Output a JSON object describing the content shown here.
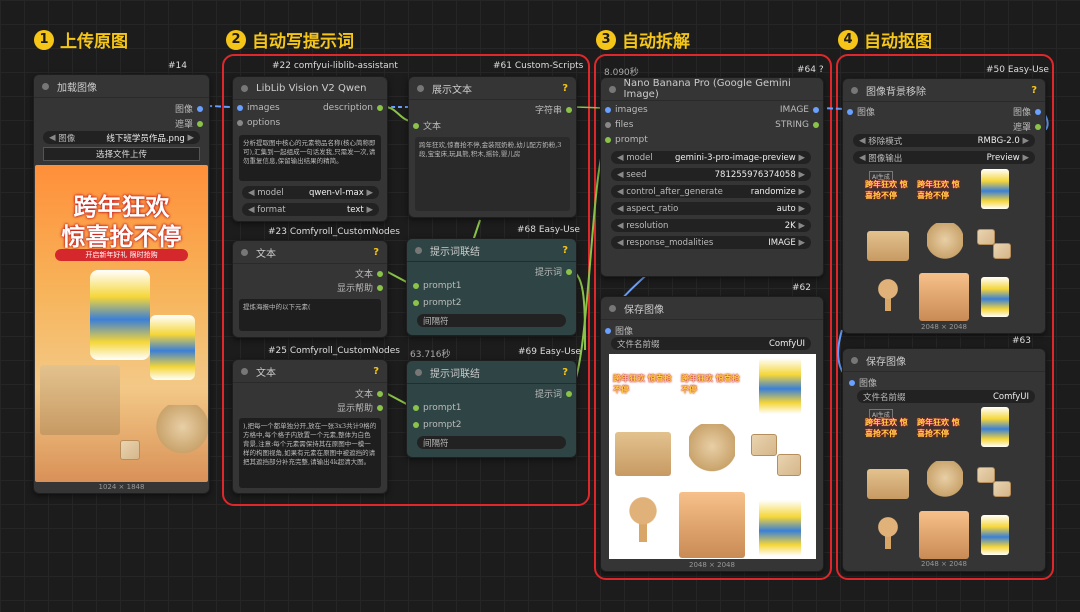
{
  "sections": [
    {
      "num": "1",
      "label": "上传原图"
    },
    {
      "num": "2",
      "label": "自动写提示词"
    },
    {
      "num": "3",
      "label": "自动拆解"
    },
    {
      "num": "4",
      "label": "自动抠图"
    }
  ],
  "colors": {
    "accent": "#f5c518",
    "group_border": "#e0282c",
    "image_port": "#6aa0ff",
    "string_port": "#8bc34a"
  },
  "nodes": {
    "load": {
      "id": "#14",
      "title": "加载图像",
      "out_image": "图像",
      "out_mask": "遮罩",
      "widget_label": "图像",
      "widget_value": "线下班学员作品.png",
      "button": "选择文件上传",
      "dims": "1024 × 1848"
    },
    "vision": {
      "id": "#22 comfyui-liblib-assistant",
      "title": "LibLib Vision V2 Qwen",
      "in_images": "images",
      "in_options": "options",
      "out_desc": "description",
      "text": "分析提取图中核心的元素物品名称(核心简称即可),汇集到一起组成一句话发我,只需发一次,请勿重复信息,保留输出结果的精简。",
      "model_label": "model",
      "model_value": "qwen-vl-max",
      "format_label": "format",
      "format_value": "text"
    },
    "show": {
      "id": "#61 Custom-Scripts",
      "title": "展示文本",
      "in_text": "文本",
      "out": "字符串",
      "text": "跨年狂欢,惊喜抢不停,金装冠奶粉,幼儿配方奶粉,3段,宝宝床,玩具熊,积木,摇铃,婴儿房"
    },
    "text23": {
      "id": "#23 Comfyroll_CustomNodes",
      "title": "文本",
      "out_text": "文本",
      "out_help": "显示帮助",
      "text": "提炼海报中的以下元素("
    },
    "concat68": {
      "id": "#68 Easy-Use",
      "title": "提示词联结",
      "out": "提示词",
      "p1": "prompt1",
      "p2": "prompt2",
      "sep": "间隔符"
    },
    "text25": {
      "id": "#25 Comfyroll_CustomNodes",
      "title": "文本",
      "out_text": "文本",
      "out_help": "显示帮助",
      "text": "),把每一个都单独分开,放在一张3x3共计9格的方格中,每个格子内放置一个元素,整体为白色背景,注意:每个元素需保持其在原图中一模一样的构图视角,如果有元素在原图中被遮挡的请把其遮挡部分补充完整,请输出4k超清大图。"
    },
    "concat69": {
      "id": "#69 Easy-Use",
      "time": "63.716秒",
      "title": "提示词联结",
      "out": "提示词",
      "p1": "prompt1",
      "p2": "prompt2",
      "sep": "间隔符"
    },
    "nano": {
      "id": "#64 ?",
      "time": "8.090秒",
      "title": "Nano Banana Pro (Google Gemini Image)",
      "in_images": "images",
      "in_files": "files",
      "in_prompt": "prompt",
      "out_image": "IMAGE",
      "out_string": "STRING",
      "widgets": [
        {
          "label": "model",
          "value": "gemini-3-pro-image-preview"
        },
        {
          "label": "seed",
          "value": "781255976374058"
        },
        {
          "label": "control_after_generate",
          "value": "randomize"
        },
        {
          "label": "aspect_ratio",
          "value": "auto"
        },
        {
          "label": "resolution",
          "value": "2K"
        },
        {
          "label": "response_modalities",
          "value": "IMAGE"
        }
      ]
    },
    "save62": {
      "id": "#62",
      "title": "保存图像",
      "in": "图像",
      "prefix_label": "文件名前缀",
      "prefix_value": "ComfyUI",
      "dims": "2048 × 2048"
    },
    "rembg": {
      "id": "#50 Easy-Use",
      "title": "图像背景移除",
      "in": "图像",
      "out_image": "图像",
      "out_mask": "遮罩",
      "mode_label": "移除模式",
      "mode_value": "RMBG-2.0",
      "output_label": "图像输出",
      "output_value": "Preview",
      "dims": "2048 × 2048"
    },
    "save63": {
      "id": "#63",
      "title": "保存图像",
      "in": "图像",
      "prefix_label": "文件名前缀",
      "prefix_value": "ComfyUI",
      "dims": "2048 × 2048"
    }
  },
  "poster": {
    "line1": "跨年狂欢",
    "line2": "惊喜抢不停",
    "sub": "开启新年好礼 限时抢购"
  },
  "grid_logo": "跨年狂欢 惊喜抢不停",
  "ai_badge": "AI生成"
}
